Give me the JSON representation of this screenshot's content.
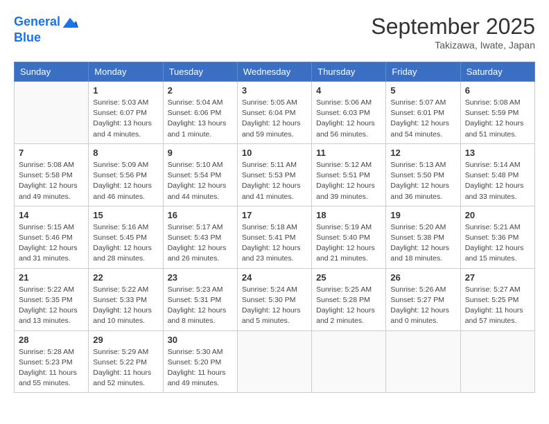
{
  "header": {
    "logo_line1": "General",
    "logo_line2": "Blue",
    "month": "September 2025",
    "location": "Takizawa, Iwate, Japan"
  },
  "weekdays": [
    "Sunday",
    "Monday",
    "Tuesday",
    "Wednesday",
    "Thursday",
    "Friday",
    "Saturday"
  ],
  "weeks": [
    [
      {
        "day": "",
        "info": ""
      },
      {
        "day": "1",
        "info": "Sunrise: 5:03 AM\nSunset: 6:07 PM\nDaylight: 13 hours\nand 4 minutes."
      },
      {
        "day": "2",
        "info": "Sunrise: 5:04 AM\nSunset: 6:06 PM\nDaylight: 13 hours\nand 1 minute."
      },
      {
        "day": "3",
        "info": "Sunrise: 5:05 AM\nSunset: 6:04 PM\nDaylight: 12 hours\nand 59 minutes."
      },
      {
        "day": "4",
        "info": "Sunrise: 5:06 AM\nSunset: 6:03 PM\nDaylight: 12 hours\nand 56 minutes."
      },
      {
        "day": "5",
        "info": "Sunrise: 5:07 AM\nSunset: 6:01 PM\nDaylight: 12 hours\nand 54 minutes."
      },
      {
        "day": "6",
        "info": "Sunrise: 5:08 AM\nSunset: 5:59 PM\nDaylight: 12 hours\nand 51 minutes."
      }
    ],
    [
      {
        "day": "7",
        "info": "Sunrise: 5:08 AM\nSunset: 5:58 PM\nDaylight: 12 hours\nand 49 minutes."
      },
      {
        "day": "8",
        "info": "Sunrise: 5:09 AM\nSunset: 5:56 PM\nDaylight: 12 hours\nand 46 minutes."
      },
      {
        "day": "9",
        "info": "Sunrise: 5:10 AM\nSunset: 5:54 PM\nDaylight: 12 hours\nand 44 minutes."
      },
      {
        "day": "10",
        "info": "Sunrise: 5:11 AM\nSunset: 5:53 PM\nDaylight: 12 hours\nand 41 minutes."
      },
      {
        "day": "11",
        "info": "Sunrise: 5:12 AM\nSunset: 5:51 PM\nDaylight: 12 hours\nand 39 minutes."
      },
      {
        "day": "12",
        "info": "Sunrise: 5:13 AM\nSunset: 5:50 PM\nDaylight: 12 hours\nand 36 minutes."
      },
      {
        "day": "13",
        "info": "Sunrise: 5:14 AM\nSunset: 5:48 PM\nDaylight: 12 hours\nand 33 minutes."
      }
    ],
    [
      {
        "day": "14",
        "info": "Sunrise: 5:15 AM\nSunset: 5:46 PM\nDaylight: 12 hours\nand 31 minutes."
      },
      {
        "day": "15",
        "info": "Sunrise: 5:16 AM\nSunset: 5:45 PM\nDaylight: 12 hours\nand 28 minutes."
      },
      {
        "day": "16",
        "info": "Sunrise: 5:17 AM\nSunset: 5:43 PM\nDaylight: 12 hours\nand 26 minutes."
      },
      {
        "day": "17",
        "info": "Sunrise: 5:18 AM\nSunset: 5:41 PM\nDaylight: 12 hours\nand 23 minutes."
      },
      {
        "day": "18",
        "info": "Sunrise: 5:19 AM\nSunset: 5:40 PM\nDaylight: 12 hours\nand 21 minutes."
      },
      {
        "day": "19",
        "info": "Sunrise: 5:20 AM\nSunset: 5:38 PM\nDaylight: 12 hours\nand 18 minutes."
      },
      {
        "day": "20",
        "info": "Sunrise: 5:21 AM\nSunset: 5:36 PM\nDaylight: 12 hours\nand 15 minutes."
      }
    ],
    [
      {
        "day": "21",
        "info": "Sunrise: 5:22 AM\nSunset: 5:35 PM\nDaylight: 12 hours\nand 13 minutes."
      },
      {
        "day": "22",
        "info": "Sunrise: 5:22 AM\nSunset: 5:33 PM\nDaylight: 12 hours\nand 10 minutes."
      },
      {
        "day": "23",
        "info": "Sunrise: 5:23 AM\nSunset: 5:31 PM\nDaylight: 12 hours\nand 8 minutes."
      },
      {
        "day": "24",
        "info": "Sunrise: 5:24 AM\nSunset: 5:30 PM\nDaylight: 12 hours\nand 5 minutes."
      },
      {
        "day": "25",
        "info": "Sunrise: 5:25 AM\nSunset: 5:28 PM\nDaylight: 12 hours\nand 2 minutes."
      },
      {
        "day": "26",
        "info": "Sunrise: 5:26 AM\nSunset: 5:27 PM\nDaylight: 12 hours\nand 0 minutes."
      },
      {
        "day": "27",
        "info": "Sunrise: 5:27 AM\nSunset: 5:25 PM\nDaylight: 11 hours\nand 57 minutes."
      }
    ],
    [
      {
        "day": "28",
        "info": "Sunrise: 5:28 AM\nSunset: 5:23 PM\nDaylight: 11 hours\nand 55 minutes."
      },
      {
        "day": "29",
        "info": "Sunrise: 5:29 AM\nSunset: 5:22 PM\nDaylight: 11 hours\nand 52 minutes."
      },
      {
        "day": "30",
        "info": "Sunrise: 5:30 AM\nSunset: 5:20 PM\nDaylight: 11 hours\nand 49 minutes."
      },
      {
        "day": "",
        "info": ""
      },
      {
        "day": "",
        "info": ""
      },
      {
        "day": "",
        "info": ""
      },
      {
        "day": "",
        "info": ""
      }
    ]
  ]
}
